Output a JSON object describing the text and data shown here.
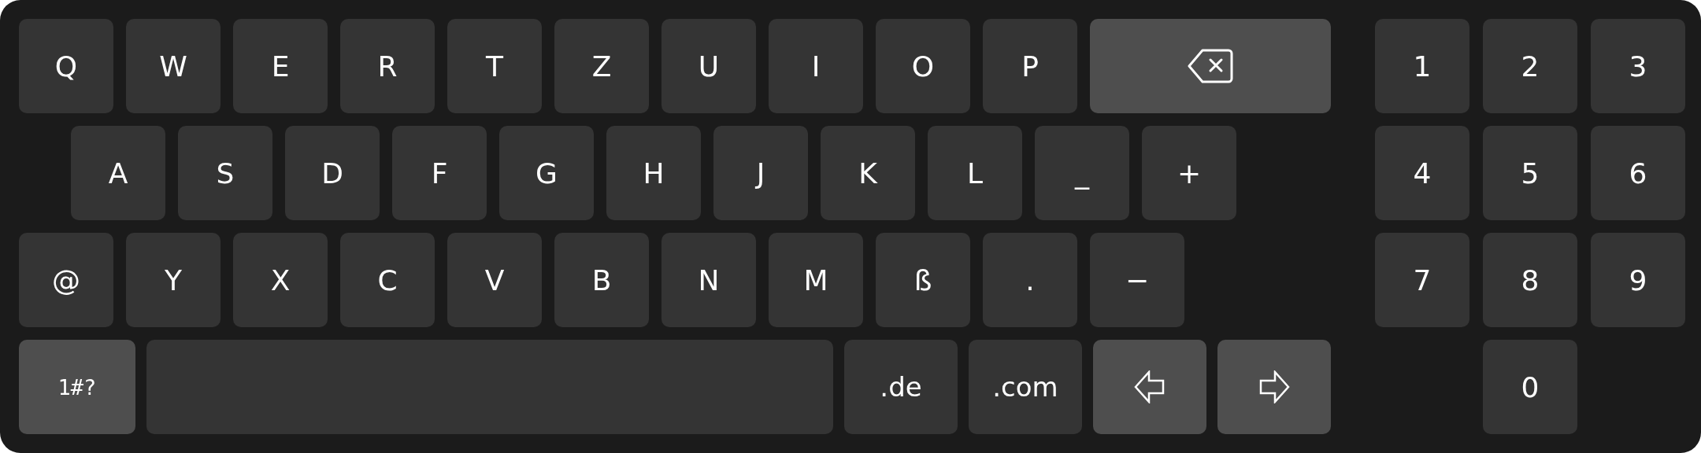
{
  "keyboard": {
    "rows": [
      [
        {
          "kind": "char",
          "label": "Q"
        },
        {
          "kind": "char",
          "label": "W"
        },
        {
          "kind": "char",
          "label": "E"
        },
        {
          "kind": "char",
          "label": "R"
        },
        {
          "kind": "char",
          "label": "T"
        },
        {
          "kind": "char",
          "label": "Z"
        },
        {
          "kind": "char",
          "label": "U"
        },
        {
          "kind": "char",
          "label": "I"
        },
        {
          "kind": "char",
          "label": "O"
        },
        {
          "kind": "char",
          "label": "P"
        },
        {
          "kind": "backspace"
        }
      ],
      [
        {
          "kind": "char",
          "label": "A"
        },
        {
          "kind": "char",
          "label": "S"
        },
        {
          "kind": "char",
          "label": "D"
        },
        {
          "kind": "char",
          "label": "F"
        },
        {
          "kind": "char",
          "label": "G"
        },
        {
          "kind": "char",
          "label": "H"
        },
        {
          "kind": "char",
          "label": "J"
        },
        {
          "kind": "char",
          "label": "K"
        },
        {
          "kind": "char",
          "label": "L"
        },
        {
          "kind": "char",
          "label": "_"
        },
        {
          "kind": "char",
          "label": "+"
        }
      ],
      [
        {
          "kind": "char",
          "label": "@"
        },
        {
          "kind": "char",
          "label": "Y"
        },
        {
          "kind": "char",
          "label": "X"
        },
        {
          "kind": "char",
          "label": "C"
        },
        {
          "kind": "char",
          "label": "V"
        },
        {
          "kind": "char",
          "label": "B"
        },
        {
          "kind": "char",
          "label": "N"
        },
        {
          "kind": "char",
          "label": "M"
        },
        {
          "kind": "char",
          "label": "ß"
        },
        {
          "kind": "char",
          "label": "."
        },
        {
          "kind": "char",
          "label": "−"
        }
      ]
    ],
    "bottom_bar": [
      {
        "kind": "mode",
        "label": "1#?"
      },
      {
        "kind": "space"
      },
      {
        "kind": "domain",
        "label": ".de"
      },
      {
        "kind": "domain",
        "label": ".com"
      },
      {
        "kind": "arrow-left"
      },
      {
        "kind": "arrow-right"
      }
    ],
    "numpad": [
      "1",
      "2",
      "3",
      "4",
      "5",
      "6",
      "7",
      "8",
      "9",
      "0"
    ]
  }
}
